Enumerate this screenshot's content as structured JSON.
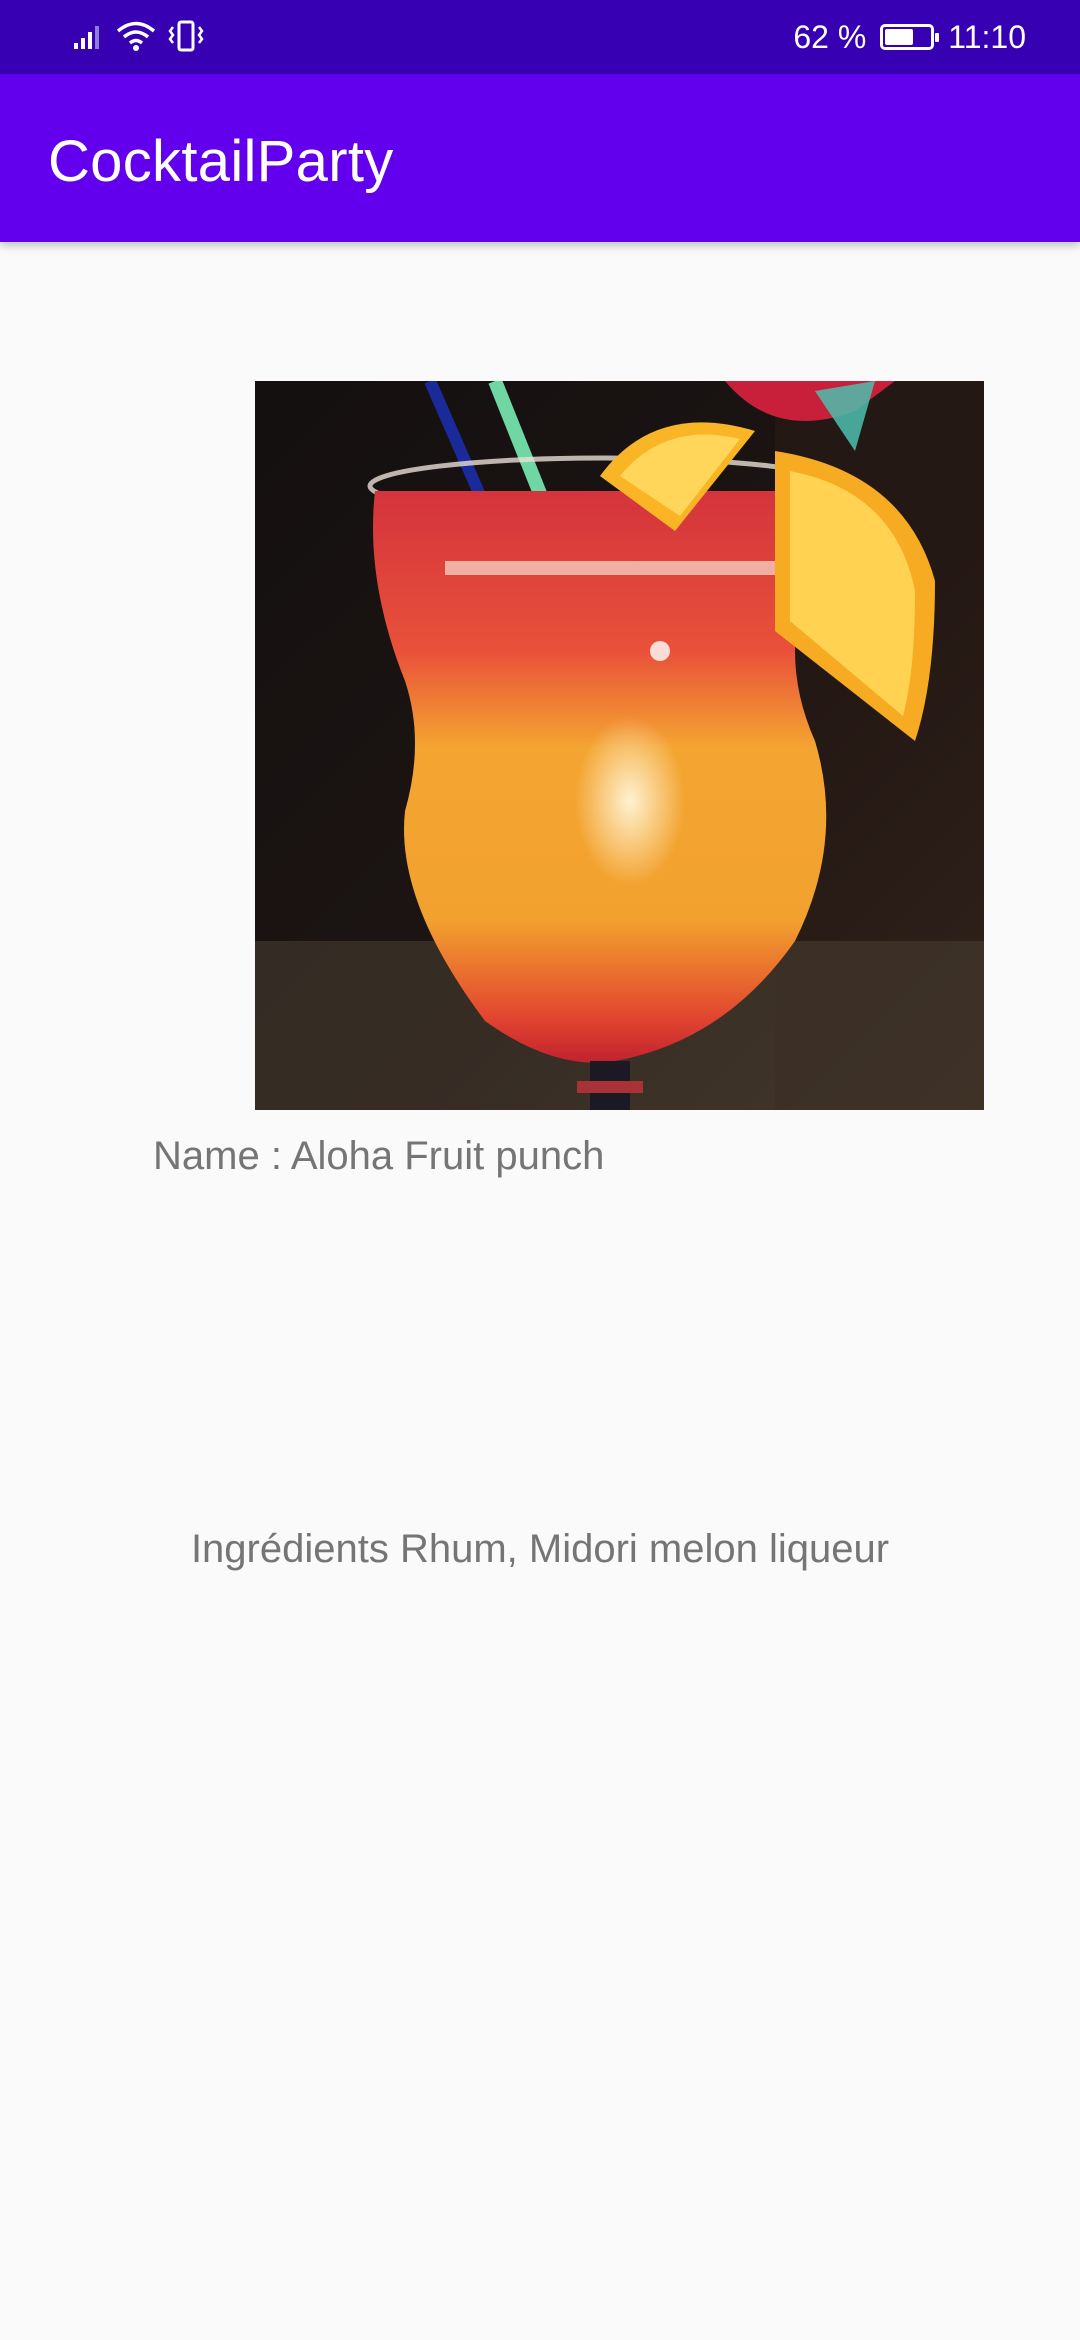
{
  "status_bar": {
    "battery_percent_label": "62 %",
    "battery_level": 0.62,
    "time": "11:10",
    "icons": [
      "signal-icon",
      "wifi-icon",
      "vibrate-icon",
      "battery-icon"
    ]
  },
  "app_bar": {
    "title": "CocktailParty",
    "color": "#6200ee",
    "status_color": "#3700b3"
  },
  "cocktail": {
    "image_subject": "cocktail-photo",
    "name_line": "Name : Aloha Fruit punch",
    "ingredients_line": "Ingrédients Rhum, Midori melon liqueur"
  }
}
